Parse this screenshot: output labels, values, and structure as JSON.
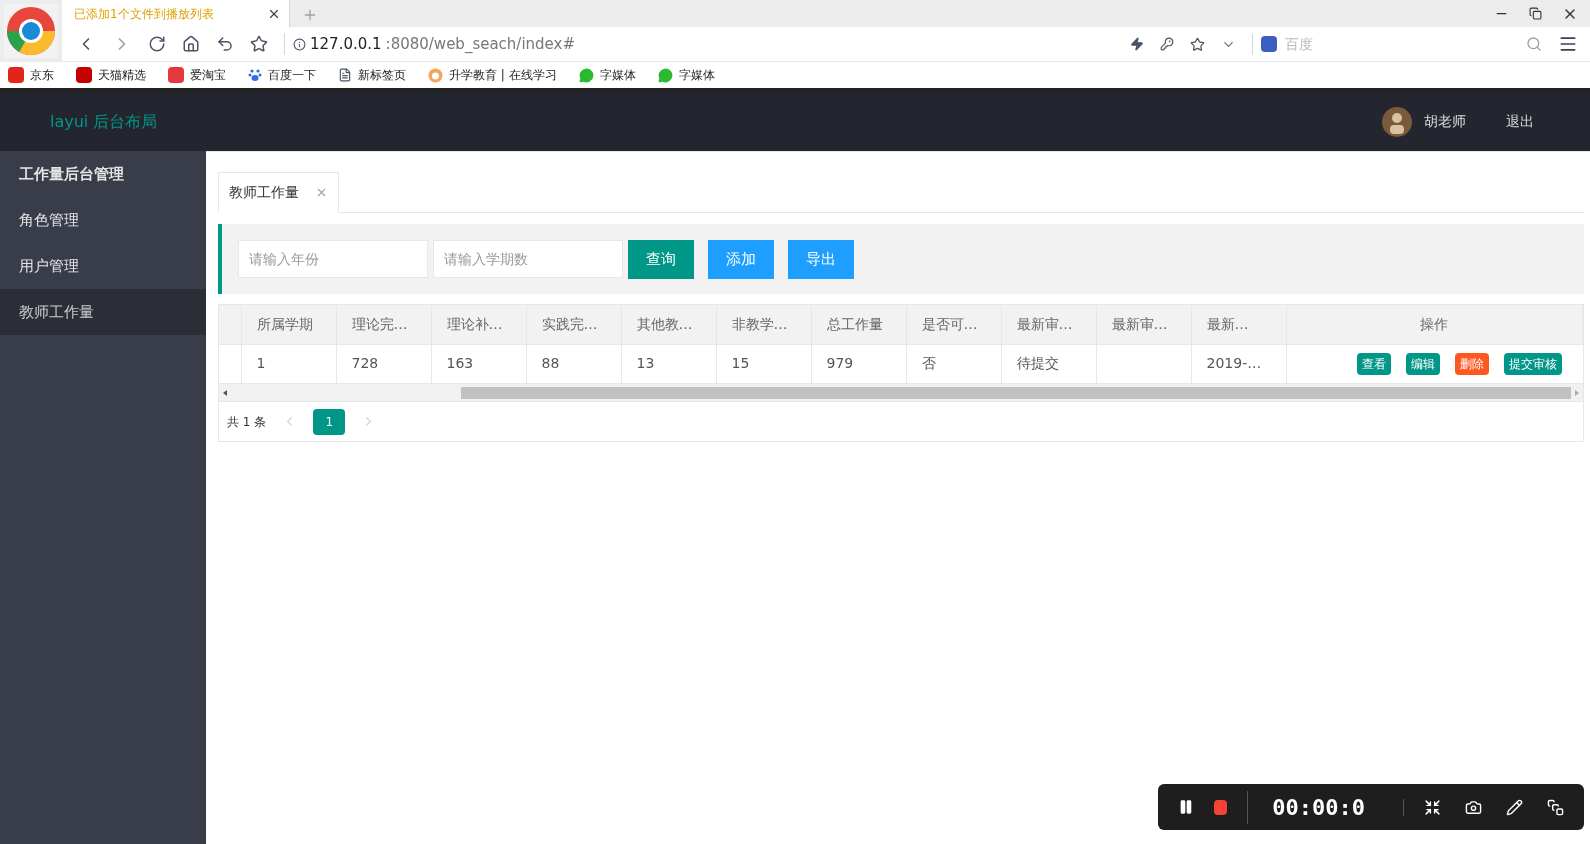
{
  "browser": {
    "notice": "已添加1个文件到播放列表",
    "url_host": "127.0.0.1",
    "url_rest": ":8080/web_seach/index#",
    "search_placeholder": "百度",
    "bookmarks": [
      {
        "label": "京东",
        "kind": "jd"
      },
      {
        "label": "天猫精选",
        "kind": "tmall"
      },
      {
        "label": "爱淘宝",
        "kind": "taobao"
      },
      {
        "label": "百度一下",
        "kind": "paw"
      },
      {
        "label": "新标签页",
        "kind": "page"
      },
      {
        "label": "升学教育 | 在线学习",
        "kind": "flame"
      },
      {
        "label": "字媒体",
        "kind": "chat"
      },
      {
        "label": "字媒体",
        "kind": "chat"
      }
    ]
  },
  "header": {
    "logo": "layui 后台布局",
    "user": "胡老师",
    "logout": "退出"
  },
  "sidebar": {
    "items": [
      {
        "label": "工作量后台管理",
        "selected": false,
        "bold": true
      },
      {
        "label": "角色管理",
        "selected": false,
        "bold": false
      },
      {
        "label": "用户管理",
        "selected": false,
        "bold": false
      },
      {
        "label": "教师工作量",
        "selected": true,
        "bold": false
      }
    ]
  },
  "tabs": [
    {
      "label": "教师工作量",
      "selected": true
    }
  ],
  "search": {
    "fields": [
      {
        "placeholder": "请输入年份"
      },
      {
        "placeholder": "请输入学期数"
      }
    ],
    "buttons": [
      {
        "label": "查询",
        "kind": "teal"
      },
      {
        "label": "添加",
        "kind": "blue"
      },
      {
        "label": "导出",
        "kind": "blue"
      }
    ]
  },
  "table": {
    "columns": [
      "所属学期",
      "理论完…",
      "理论补…",
      "实践完…",
      "其他教…",
      "非教学…",
      "总工作量",
      "是否可…",
      "最新审…",
      "最新审…",
      "最新…",
      "操作"
    ],
    "rows": [
      {
        "cells": [
          "1",
          "728",
          "163",
          "88",
          "13",
          "15",
          "979",
          "否",
          "待提交",
          "",
          "2019-…"
        ],
        "actions": [
          {
            "label": "查看",
            "kind": "teal"
          },
          {
            "label": "编辑",
            "kind": "teal"
          },
          {
            "label": "删除",
            "kind": "orange"
          },
          {
            "label": "提交审核",
            "kind": "teal"
          }
        ]
      }
    ]
  },
  "pagination": {
    "total": "共 1 条",
    "pages": [
      {
        "label": "1",
        "selected": true
      }
    ]
  },
  "recorder": {
    "time": "00:00:0"
  }
}
